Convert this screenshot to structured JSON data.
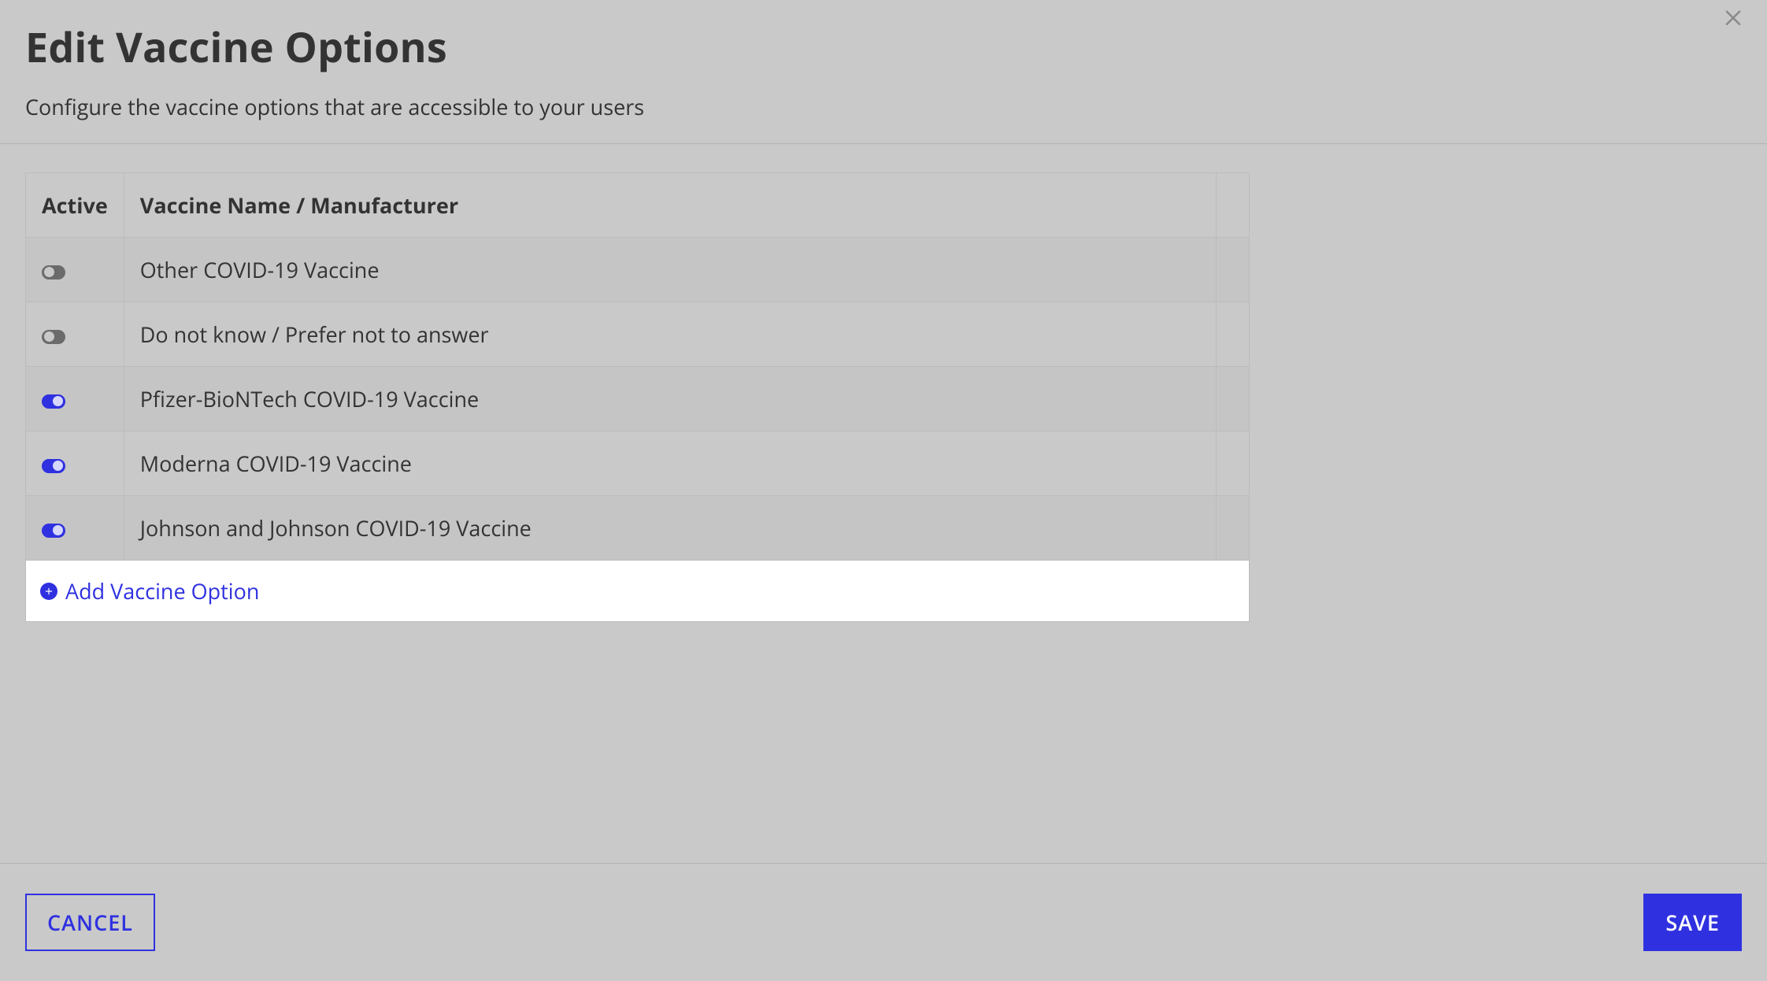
{
  "header": {
    "title": "Edit Vaccine Options",
    "subtitle": "Configure the vaccine options that are accessible to your users"
  },
  "table": {
    "columns": {
      "active": "Active",
      "name": "Vaccine Name / Manufacturer"
    },
    "rows": [
      {
        "active": false,
        "name": "Other COVID-19 Vaccine"
      },
      {
        "active": false,
        "name": "Do not know / Prefer not to answer"
      },
      {
        "active": true,
        "name": "Pfizer-BioNTech COVID-19 Vaccine"
      },
      {
        "active": true,
        "name": "Moderna COVID-19 Vaccine"
      },
      {
        "active": true,
        "name": "Johnson and Johnson COVID-19 Vaccine"
      }
    ],
    "add_label": "Add Vaccine Option"
  },
  "footer": {
    "cancel": "CANCEL",
    "save": "SAVE"
  }
}
